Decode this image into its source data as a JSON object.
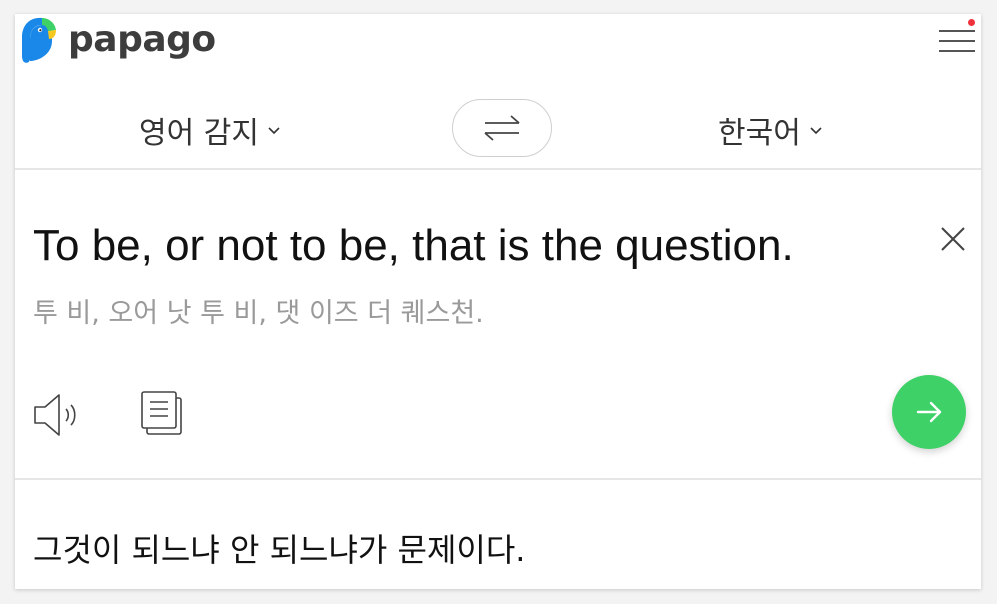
{
  "app": {
    "logo_text": "papago",
    "brand_colors": {
      "bird_blue": "#1a88e8",
      "bird_green": "#3ed167",
      "bird_yellow": "#f7c81e",
      "accent_green": "#3ed167",
      "notification_red": "#f0323c"
    }
  },
  "header": {
    "menu_icon": "hamburger-menu-icon",
    "has_notification": true
  },
  "languages": {
    "source": "영어 감지",
    "target": "한국어",
    "swap_icon": "swap-arrows-icon"
  },
  "source": {
    "text": "To be, or not to be, that is the question.",
    "pronunciation": "투 비, 오어 낫 투 비, 댓 이즈 더 퀘스천.",
    "clear_icon": "close-icon",
    "speaker_icon": "speaker-icon",
    "copy_icon": "copy-icon",
    "translate_icon": "arrow-right-icon"
  },
  "result": {
    "text": "그것이 되느냐 안 되느냐가 문제이다."
  }
}
